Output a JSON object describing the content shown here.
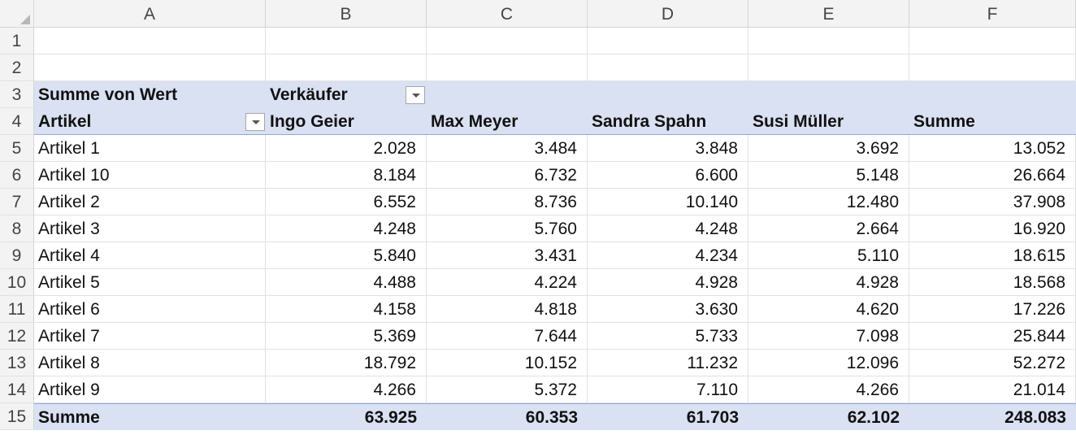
{
  "columns": [
    "A",
    "B",
    "C",
    "D",
    "E",
    "F"
  ],
  "row_numbers": [
    "1",
    "2",
    "3",
    "4",
    "5",
    "6",
    "7",
    "8",
    "9",
    "10",
    "11",
    "12",
    "13",
    "14",
    "15"
  ],
  "pivot": {
    "value_label": "Summe von Wert",
    "column_field_label": "Verkäufer",
    "row_field_label": "Artikel",
    "sellers": [
      "Ingo Geier",
      "Max Meyer",
      "Sandra Spahn",
      "Susi Müller"
    ],
    "total_column_label": "Summe",
    "rows": [
      {
        "label": "Artikel 1",
        "values": [
          "2.028",
          "3.484",
          "3.848",
          "3.692",
          "13.052"
        ]
      },
      {
        "label": "Artikel 10",
        "values": [
          "8.184",
          "6.732",
          "6.600",
          "5.148",
          "26.664"
        ]
      },
      {
        "label": "Artikel 2",
        "values": [
          "6.552",
          "8.736",
          "10.140",
          "12.480",
          "37.908"
        ]
      },
      {
        "label": "Artikel 3",
        "values": [
          "4.248",
          "5.760",
          "4.248",
          "2.664",
          "16.920"
        ]
      },
      {
        "label": "Artikel 4",
        "values": [
          "5.840",
          "3.431",
          "4.234",
          "5.110",
          "18.615"
        ]
      },
      {
        "label": "Artikel 5",
        "values": [
          "4.488",
          "4.224",
          "4.928",
          "4.928",
          "18.568"
        ]
      },
      {
        "label": "Artikel 6",
        "values": [
          "4.158",
          "4.818",
          "3.630",
          "4.620",
          "17.226"
        ]
      },
      {
        "label": "Artikel 7",
        "values": [
          "5.369",
          "7.644",
          "5.733",
          "7.098",
          "25.844"
        ]
      },
      {
        "label": "Artikel 8",
        "values": [
          "18.792",
          "10.152",
          "11.232",
          "12.096",
          "52.272"
        ]
      },
      {
        "label": "Artikel 9",
        "values": [
          "4.266",
          "5.372",
          "7.110",
          "4.266",
          "21.014"
        ]
      }
    ],
    "total_row": {
      "label": "Summe",
      "values": [
        "63.925",
        "60.353",
        "61.703",
        "62.102",
        "248.083"
      ]
    }
  },
  "colors": {
    "pivot_header_fill": "#d9e1f2",
    "pivot_border": "#8ea9db",
    "header_bg": "#f3f3f3"
  }
}
